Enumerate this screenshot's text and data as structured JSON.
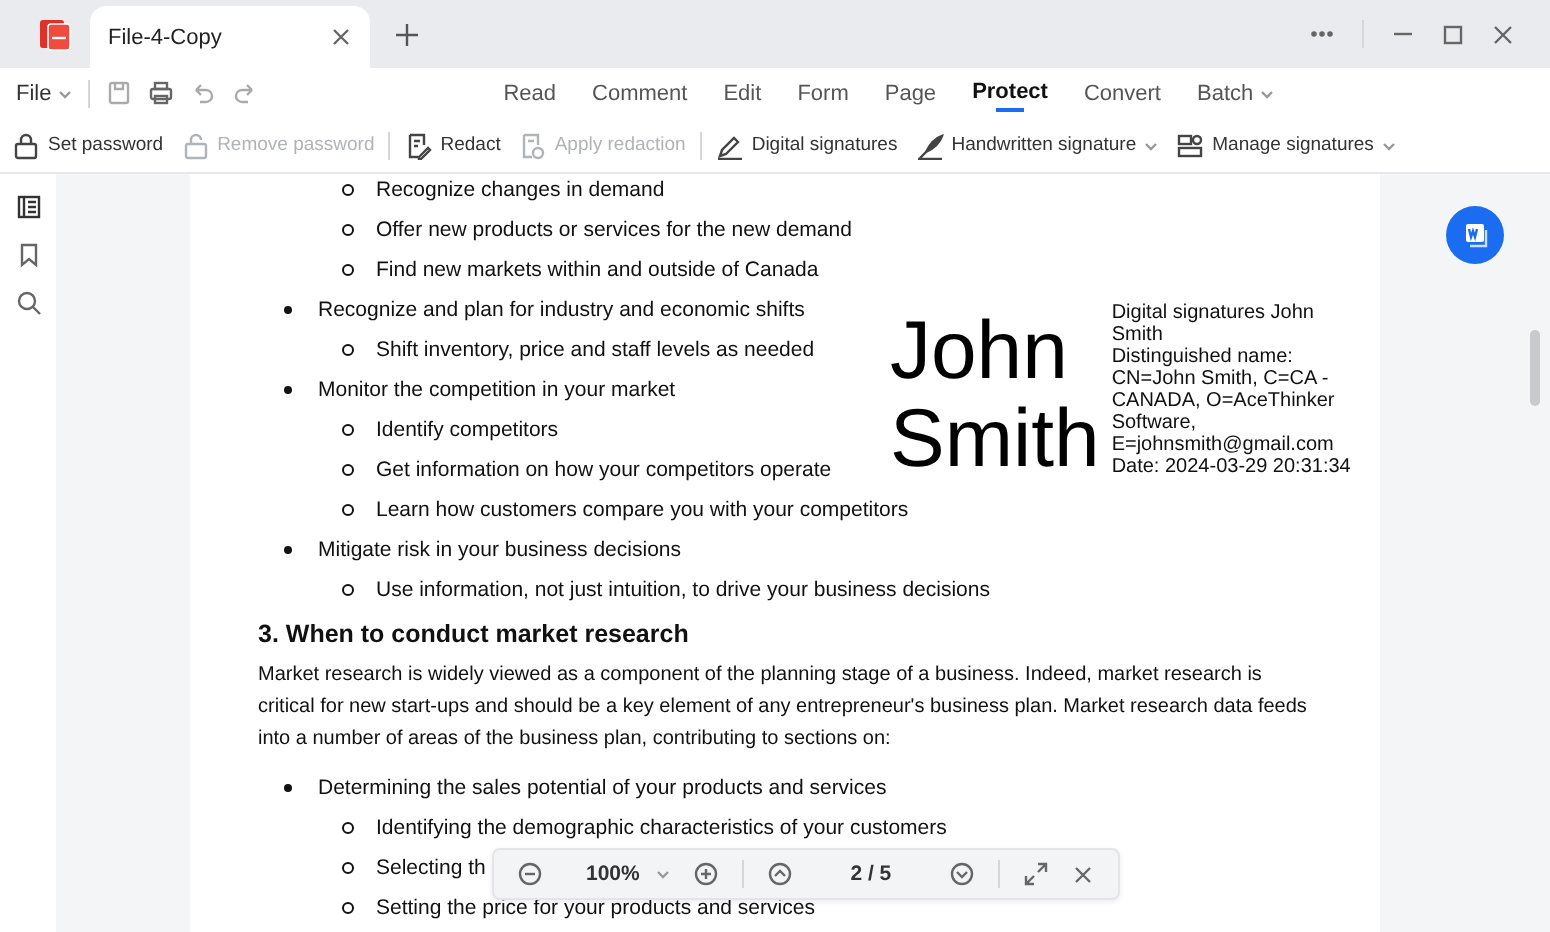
{
  "window": {
    "tab_title": "File-4-Copy"
  },
  "menu": {
    "file": "File",
    "tabs": [
      {
        "label": "Read",
        "selected": false
      },
      {
        "label": "Comment",
        "selected": false
      },
      {
        "label": "Edit",
        "selected": false
      },
      {
        "label": "Form",
        "selected": false
      },
      {
        "label": "Page",
        "selected": false
      },
      {
        "label": "Protect",
        "selected": true
      },
      {
        "label": "Convert",
        "selected": false
      },
      {
        "label": "Batch",
        "selected": false,
        "dropdown": true
      }
    ]
  },
  "toolbar": [
    {
      "kind": "lock",
      "label": "Set password",
      "disabled": false
    },
    {
      "kind": "unlock",
      "label": "Remove password",
      "disabled": true
    },
    {
      "kind": "separator"
    },
    {
      "kind": "redact",
      "label": "Redact",
      "disabled": false
    },
    {
      "kind": "apply",
      "label": "Apply redaction",
      "disabled": true
    },
    {
      "kind": "separator"
    },
    {
      "kind": "pen",
      "label": "Digital signatures",
      "disabled": false
    },
    {
      "kind": "quill",
      "label": "Handwritten signature",
      "disabled": false,
      "dropdown": true
    },
    {
      "kind": "manage",
      "label": "Manage signatures",
      "disabled": false,
      "dropdown": true
    }
  ],
  "document": {
    "blocks": [
      {
        "kind": "sub",
        "text": "Recognize changes in demand"
      },
      {
        "kind": "sub",
        "text": "Offer new products or services for the new demand"
      },
      {
        "kind": "sub",
        "text": "Find new markets within and outside of Canada"
      },
      {
        "kind": "bullet",
        "text": "Recognize and plan for industry and economic shifts"
      },
      {
        "kind": "sub",
        "text": "Shift inventory, price and staff levels as needed"
      },
      {
        "kind": "bullet",
        "text": "Monitor the competition in your market"
      },
      {
        "kind": "sub",
        "text": "Identify competitors"
      },
      {
        "kind": "sub",
        "text": "Get information on how your competitors operate"
      },
      {
        "kind": "sub",
        "text": "Learn how customers compare you with your competitors"
      },
      {
        "kind": "bullet",
        "text": "Mitigate risk in your business decisions"
      },
      {
        "kind": "sub",
        "text": "Use information, not just intuition, to drive your business decisions"
      },
      {
        "kind": "heading",
        "text": "3. When to conduct market research"
      },
      {
        "kind": "paragraph",
        "text": "Market research is widely viewed as a component of the planning stage of a business. Indeed, market research is critical for new start-ups and should be a key element of any entrepreneur's business plan. Market research data feeds into a number of areas of the business plan, contributing to sections on:"
      },
      {
        "kind": "bullet",
        "text": "Determining the sales potential of your products and services"
      },
      {
        "kind": "sub",
        "text": "Identifying the demographic characteristics of your customers"
      },
      {
        "kind": "sub",
        "text": "Selecting th"
      },
      {
        "kind": "sub",
        "text": "Setting the price for your products and services"
      }
    ],
    "signature": {
      "name_lines": [
        "John",
        "Smith"
      ],
      "details": [
        "Digital signatures John Smith",
        "Distinguished name: CN=John Smith, C=CA - CANADA, O=AceThinker Software, E=johnsmith@gmail.com",
        "Date: 2024-03-29 20:31:34"
      ]
    }
  },
  "zoom_bar": {
    "zoom": "100%",
    "page": "2 / 5"
  }
}
